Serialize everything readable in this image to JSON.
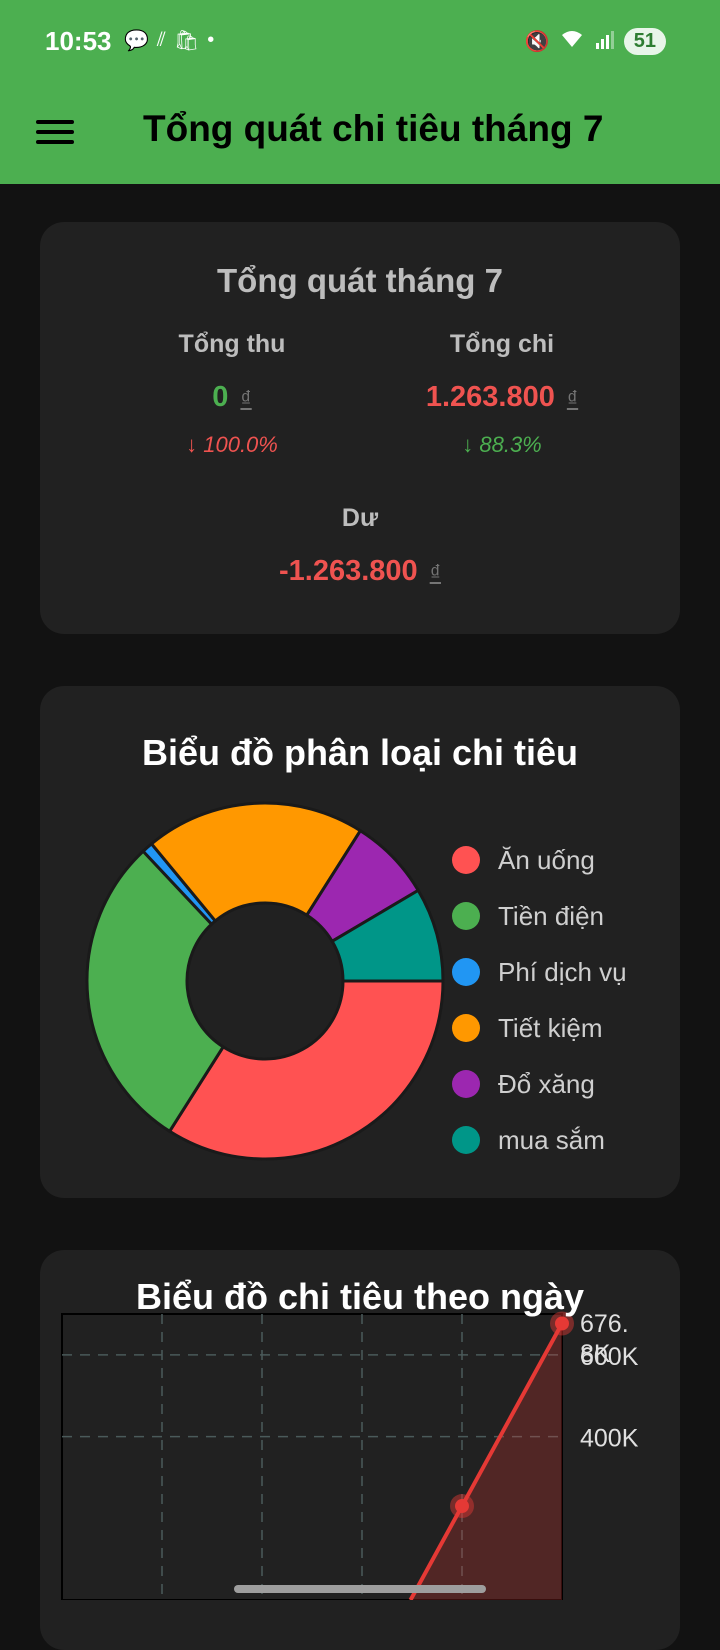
{
  "status_bar": {
    "time": "10:53",
    "battery": "51",
    "left_icons": [
      "chat-icon",
      "signal-bars-icon",
      "shop-icon",
      "dot-icon"
    ],
    "right_icons": [
      "mute-icon",
      "wifi-icon",
      "cell-signal-icon"
    ]
  },
  "app_bar": {
    "title": "Tổng quát chi tiêu tháng 7",
    "menu_icon": "menu-icon"
  },
  "summary": {
    "title": "Tổng quát tháng 7",
    "income": {
      "label": "Tổng thu",
      "value": "0",
      "currency": "₫",
      "change": "↓ 100.0%"
    },
    "expense": {
      "label": "Tổng chi",
      "value": "1.263.800",
      "currency": "₫",
      "change": "↓ 88.3%"
    },
    "balance": {
      "label": "Dư",
      "value": "-1.263.800",
      "currency": "₫"
    },
    "colors": {
      "positive": "#4caf50",
      "negative": "#ef5350"
    }
  },
  "category_chart": {
    "title": "Biểu đồ phân loại chi tiêu",
    "legend": [
      {
        "label": "Ăn uống",
        "color": "#ff5252"
      },
      {
        "label": "Tiền điện",
        "color": "#4caf50"
      },
      {
        "label": "Phí dịch vụ",
        "color": "#2196f3"
      },
      {
        "label": "Tiết kiệm",
        "color": "#ff9800"
      },
      {
        "label": "Đổ xăng",
        "color": "#9c27b0"
      },
      {
        "label": "mua sắm",
        "color": "#009688"
      }
    ]
  },
  "daily_chart": {
    "title": "Biểu đồ chi tiêu theo ngày",
    "y_tick_labels": [
      "600K",
      "400K"
    ],
    "peak_label_line1": "676.",
    "peak_label_line2": "8K",
    "line_color": "#e53935"
  },
  "chart_data": [
    {
      "type": "pie",
      "title": "Biểu đồ phân loại chi tiêu",
      "categories": [
        "Ăn uống",
        "Tiền điện",
        "Phí dịch vụ",
        "Tiết kiệm",
        "Đổ xăng",
        "mua sắm"
      ],
      "values": [
        34,
        29,
        1,
        20,
        7.5,
        8.5
      ],
      "colors": [
        "#ff5252",
        "#4caf50",
        "#2196f3",
        "#ff9800",
        "#9c27b0",
        "#009688"
      ]
    },
    {
      "type": "area",
      "title": "Biểu đồ chi tiêu theo ngày",
      "x": [
        5,
        6
      ],
      "y": [
        230000,
        676800
      ],
      "ylim": [
        0,
        700000
      ],
      "yticks": [
        400000,
        600000
      ],
      "grid": true
    }
  ]
}
